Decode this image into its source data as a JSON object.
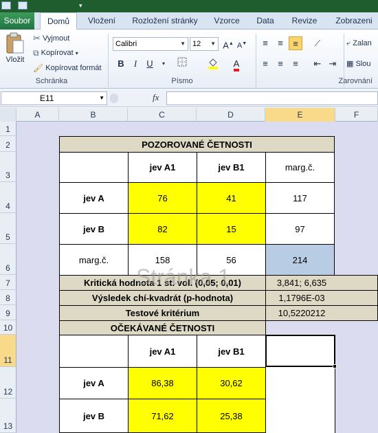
{
  "ribbon_tabs": [
    {
      "label": "Soubor"
    },
    {
      "label": "Domů"
    },
    {
      "label": "Vložení"
    },
    {
      "label": "Rozložení stránky"
    },
    {
      "label": "Vzorce"
    },
    {
      "label": "Data"
    },
    {
      "label": "Revize"
    },
    {
      "label": "Zobrazeni"
    }
  ],
  "clipboard": {
    "paste": "Vložit",
    "cut": "Vyjmout",
    "copy": "Kopírovat",
    "format_painter": "Kopírovat formát",
    "group": "Schránka"
  },
  "font": {
    "name": "Calibri",
    "size": "12",
    "group": "Písmo",
    "bold": "B",
    "italic": "I",
    "underline": "U"
  },
  "alignment": {
    "wrap": "Zalan",
    "merge": "Slou",
    "group": "Zarovnání"
  },
  "formula_bar": {
    "name_box": "E11",
    "fx": "fx",
    "formula": ""
  },
  "columns": [
    "A",
    "B",
    "C",
    "D",
    "E",
    "F"
  ],
  "rows": [
    "1",
    "2",
    "3",
    "4",
    "5",
    "6",
    "7",
    "8",
    "9",
    "10",
    "11",
    "12",
    "13"
  ],
  "table_observed": {
    "title": "POZOROVANÉ ČETNOSTI",
    "col1": "jev A1",
    "col2": "jev B1",
    "col3": "marg.č.",
    "rowA": {
      "label": "jev A",
      "v1": "76",
      "v2": "41",
      "sum": "117"
    },
    "rowB": {
      "label": "jev B",
      "v1": "82",
      "v2": "15",
      "sum": "97"
    },
    "rowM": {
      "label": "marg.č.",
      "v1": "158",
      "v2": "56",
      "sum": "214"
    }
  },
  "stats": {
    "critical_label": "Kritická hodnota 1 st. vol. (0,05; 0,01)",
    "critical_value": "3,841; 6,635",
    "chi_label": "Výsledek chí-kvadrát (p-hodnota)",
    "chi_value": "1,1796E-03",
    "test_label": "Testové kritérium",
    "test_value": "10,5220212"
  },
  "table_expected": {
    "title": "OČEKÁVANÉ ČETNOSTI",
    "col1": "jev A1",
    "col2": "jev B1",
    "rowA": {
      "label": "jev A",
      "v1": "86,38",
      "v2": "30,62"
    },
    "rowB": {
      "label": "jev B",
      "v1": "71,62",
      "v2": "25,38"
    }
  },
  "watermark": "Stránka 1",
  "colors": {
    "yellow": "#ffff00",
    "tan": "#ddd9c4",
    "blue": "#b8cce4",
    "file_tab": "#217346"
  }
}
